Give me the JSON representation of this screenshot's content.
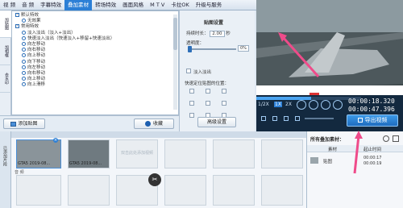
{
  "tabs": [
    "视 频",
    "音 频",
    "字幕特效",
    "叠加素材",
    "转场特效",
    "画面风格",
    "M T V",
    "卡拉OK",
    "升级与服务"
  ],
  "active_tab": "叠加素材",
  "side_tabs": [
    "加贴图",
    "加相框",
    "去水印"
  ],
  "effects": [
    {
      "label": "默认特效",
      "group": true
    },
    {
      "label": "无效果",
      "group": false
    },
    {
      "label": "常用特效",
      "group": true
    },
    {
      "label": "淡入淡出（淡入+淡出）",
      "group": false
    },
    {
      "label": "快速淡入淡出（快速淡入+移留+快速淡出）",
      "group": false
    },
    {
      "label": "向左移动",
      "group": false
    },
    {
      "label": "向右移动",
      "group": false
    },
    {
      "label": "向上移动",
      "group": false
    },
    {
      "label": "向下移动",
      "group": false
    },
    {
      "label": "向左移动",
      "group": false
    },
    {
      "label": "向右移动",
      "group": false
    },
    {
      "label": "向上移动",
      "group": false
    },
    {
      "label": "向上滑移",
      "group": false
    }
  ],
  "bottom_left": {
    "add_sticker": "添加贴图",
    "collect": "收藏"
  },
  "settings": {
    "title": "贴图设置",
    "duration_label": "持续时长：",
    "duration_value": "2.00",
    "duration_unit": "秒",
    "opacity_label": "透明度：",
    "opacity_value": "0%",
    "fade_label": "淡入淡出",
    "position_label": "快速定位贴图的位置：",
    "advanced": "高级设置"
  },
  "player": {
    "speeds": [
      "1/2X",
      "1X",
      "2X"
    ],
    "active_speed": "1X",
    "time_current": "00:00:18.320",
    "time_total": "00:00:47.396",
    "export": "导出视频"
  },
  "timeline": {
    "side": "已添加片段",
    "clips": [
      {
        "name": "GTA5 2019-08..."
      },
      {
        "name": "GTA5 2019-08..."
      }
    ],
    "placeholder": "双击此处添加视频",
    "audio_label": "音 频"
  },
  "manager": {
    "title": "所有叠加素材：",
    "col1": "素材",
    "col2": "起止时间",
    "row_name": "贴图",
    "row_start": "00:00:17",
    "row_end": "00:00:19"
  }
}
